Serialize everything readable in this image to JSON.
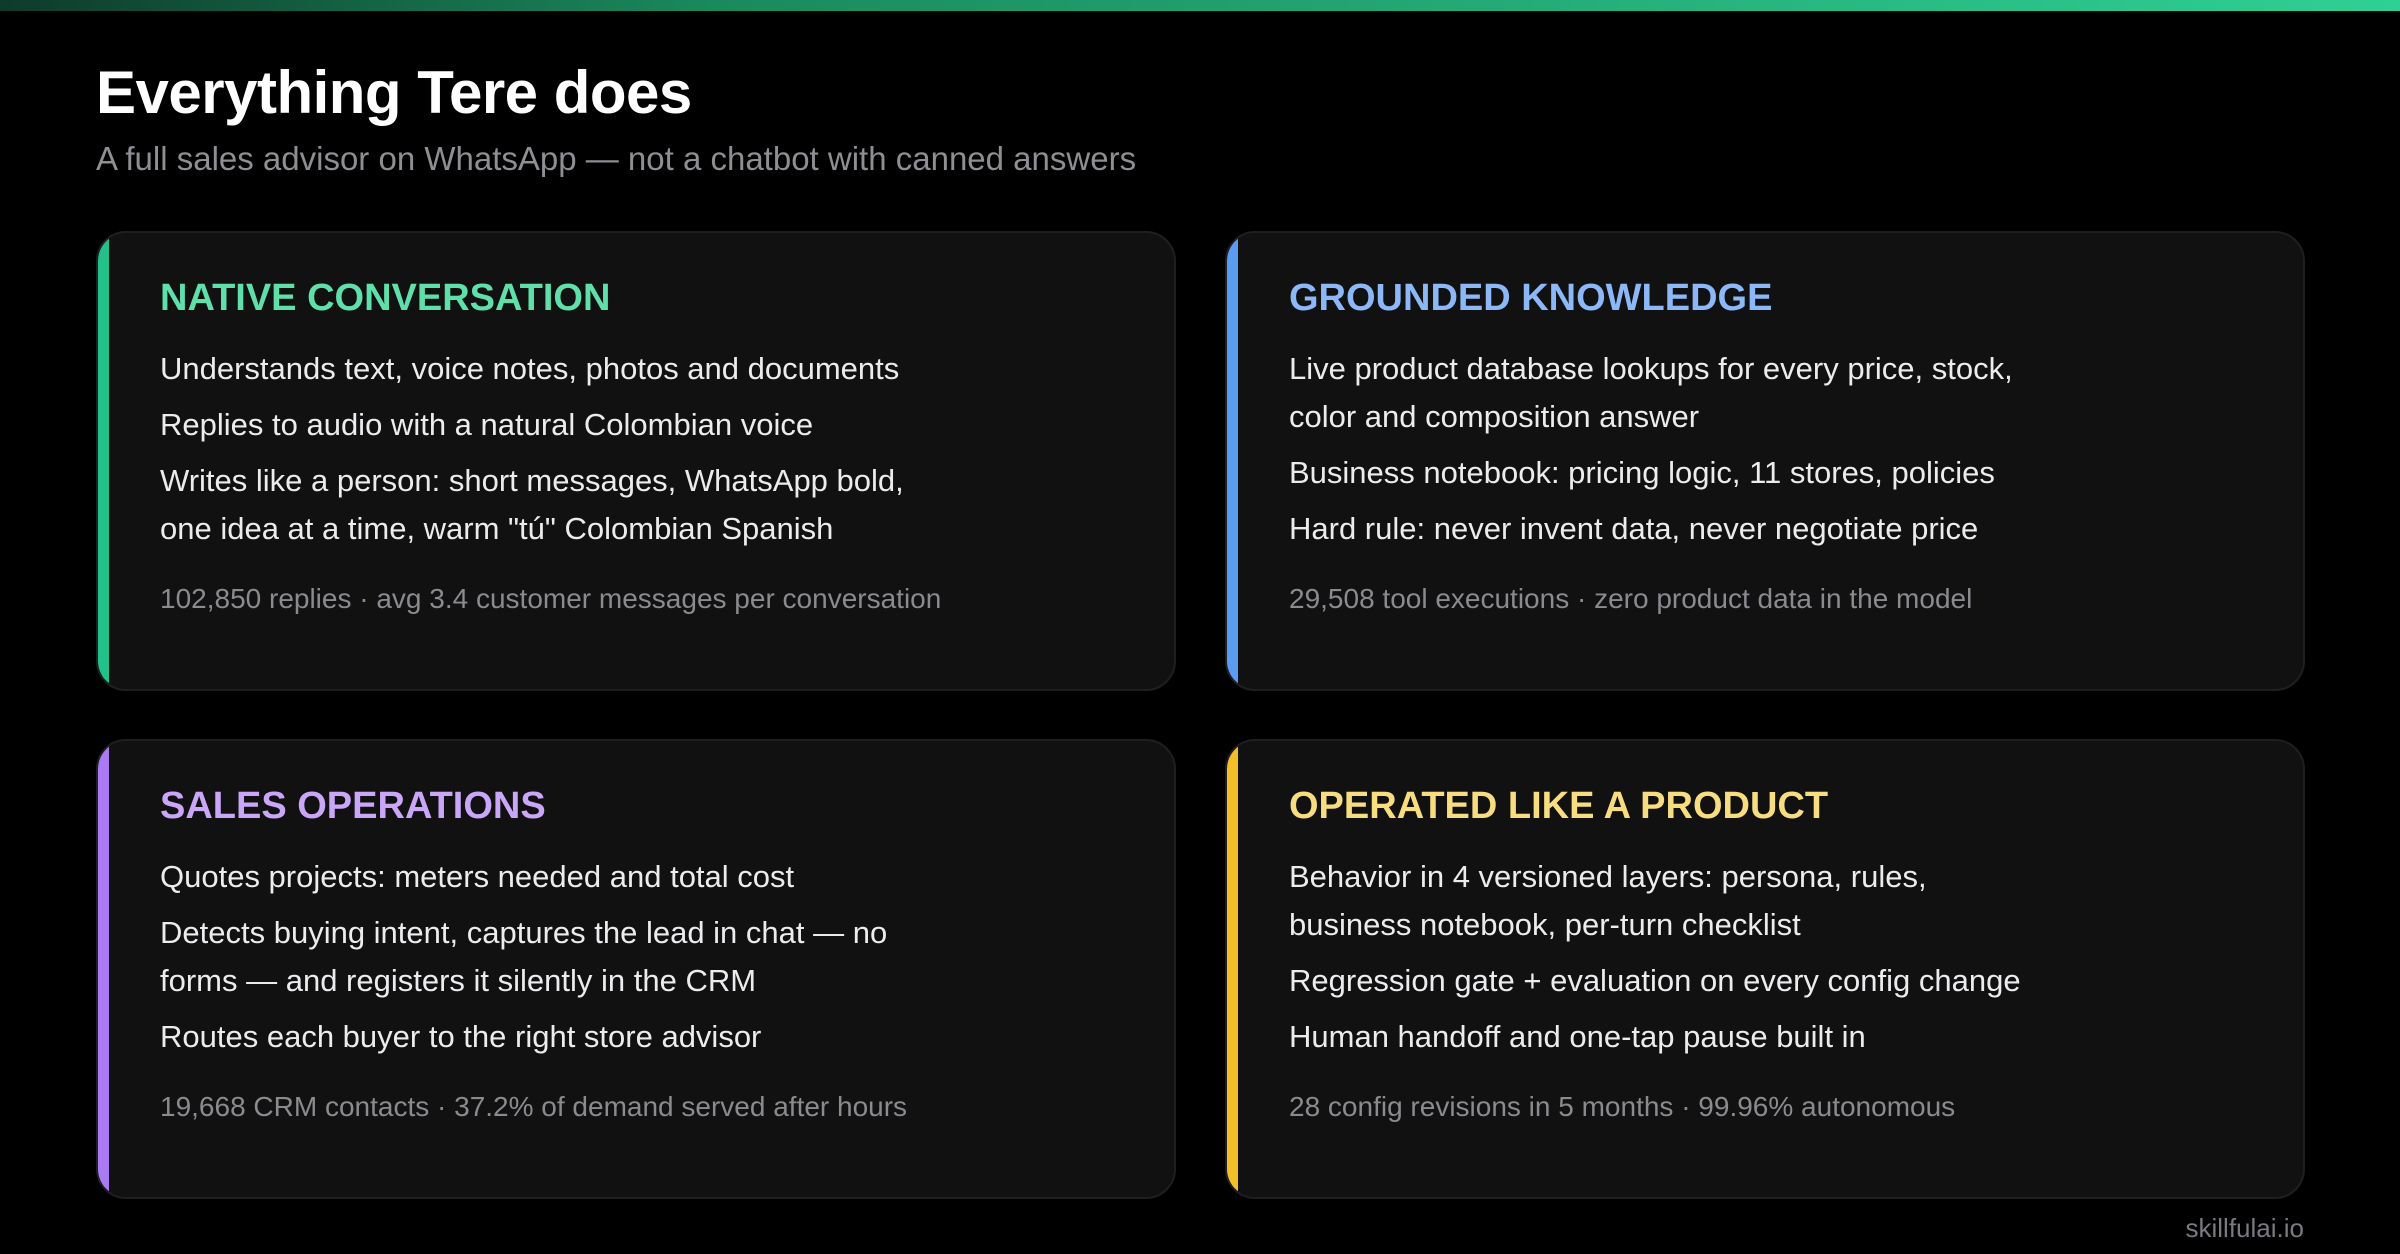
{
  "header": {
    "title": "Everything Tere does",
    "subtitle": "A full sales advisor on WhatsApp — not a chatbot with canned answers"
  },
  "cards": [
    {
      "heading": "NATIVE CONVERSATION",
      "accent_color": "#22c08a",
      "heading_color": "#5fe0ab",
      "bullets": [
        "Understands text, voice notes, photos and documents",
        "Replies to audio with a natural Colombian voice",
        "Writes like a person: short messages, WhatsApp bold, one idea at a time, warm \"tú\" Colombian Spanish"
      ],
      "stat": "102,850 replies · avg 3.4 customer messages per conversation"
    },
    {
      "heading": "GROUNDED KNOWLEDGE",
      "accent_color": "#5b9cf2",
      "heading_color": "#8cb8f7",
      "bullets": [
        "Live product database lookups for every price, stock, color and composition answer",
        "Business notebook: pricing logic, 11 stores, policies",
        "Hard rule: never invent data, never negotiate price"
      ],
      "stat": "29,508 tool executions · zero product data in the model"
    },
    {
      "heading": "SALES OPERATIONS",
      "accent_color": "#a97af2",
      "heading_color": "#c9a6f7",
      "bullets": [
        "Quotes projects: meters needed and total cost",
        "Detects buying intent, captures the lead in chat — no forms — and registers it silently in the CRM",
        "Routes each buyer to the right store advisor"
      ],
      "stat": "19,668 CRM contacts · 37.2% of demand served after hours"
    },
    {
      "heading": "OPERATED LIKE A PRODUCT",
      "accent_color": "#f2bf2a",
      "heading_color": "#f7dc80",
      "bullets": [
        "Behavior in 4 versioned layers: persona, rules, business notebook, per-turn checklist",
        "Regression gate + evaluation on every config change",
        "Human handoff and one-tap pause built in"
      ],
      "stat": "28 config revisions in 5 months · 99.96% autonomous"
    }
  ],
  "footer": {
    "text": "skillfulai.io"
  }
}
